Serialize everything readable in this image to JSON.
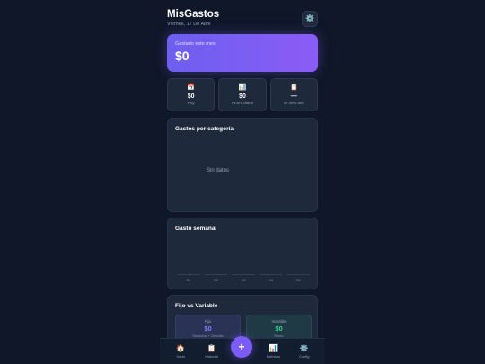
{
  "header": {
    "title": "MisGastos",
    "date": "Viernes, 17 De Abril",
    "settings_icon": "⚙️"
  },
  "hero": {
    "label": "Gastado este mes",
    "value": "$0"
  },
  "stats": [
    {
      "icon": "📅",
      "value": "$0",
      "label": "Hoy"
    },
    {
      "icon": "📊",
      "value": "$0",
      "label": "Prom. diario"
    },
    {
      "icon": "📋",
      "value": "—",
      "label": "vs mes ant."
    }
  ],
  "category_card": {
    "title": "Gastos por categoría",
    "empty_text": "Sin datos"
  },
  "weekly_card": {
    "title": "Gasto semanal",
    "labels": [
      "S1",
      "S2",
      "S3",
      "S4",
      "S5"
    ]
  },
  "fixed_variable_card": {
    "title": "Fijo vs Variable",
    "fixed": {
      "label": "Fijo",
      "value": "$0",
      "sub": "Servicios + Deudas"
    },
    "variable": {
      "label": "Variable",
      "value": "$0",
      "sub": "Resto"
    }
  },
  "nav": {
    "items": [
      {
        "icon": "🏠",
        "label": "Inicio"
      },
      {
        "icon": "📋",
        "label": "Historial"
      },
      {
        "icon": "📊",
        "label": "Métricas"
      },
      {
        "icon": "⚙️",
        "label": "Config"
      }
    ],
    "fab_label": "+"
  },
  "colors": {
    "background": "#0f1729",
    "card": "#1e293b",
    "accent": "#7c5cf6",
    "positive": "#34d399"
  }
}
